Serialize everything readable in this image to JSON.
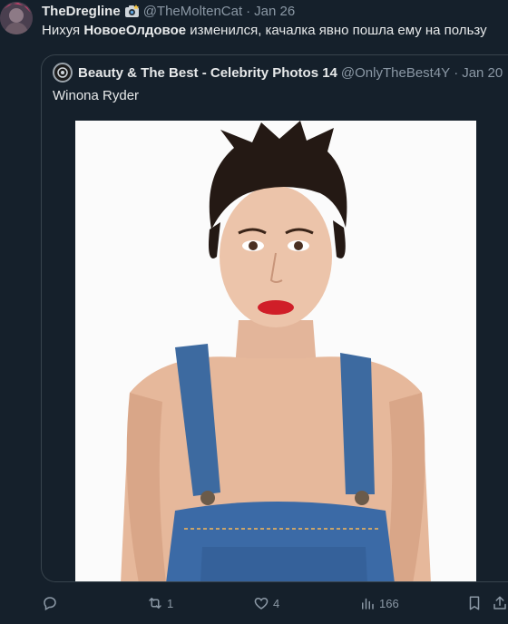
{
  "tweet": {
    "author_name": "TheDregline",
    "author_handle": "@TheMoltenCat",
    "separator": "·",
    "time": "Jan 26",
    "text_prefix": "Нихуя ",
    "text_bold": "НовоеОлдовое",
    "text_suffix": " изменился, качалка явно пошла ему на пользу"
  },
  "quote": {
    "author_name": "Beauty & The Best - Celebrity Photos 14",
    "author_handle": "@OnlyTheBest4Y",
    "separator": "·",
    "time": "Jan 20",
    "text": "Winona Ryder"
  },
  "actions": {
    "reply_icon": "reply-icon",
    "retweet_icon": "retweet-icon",
    "retweet_count": "1",
    "like_icon": "heart-icon",
    "like_count": "4",
    "views_icon": "views-icon",
    "views_count": "166",
    "bookmark_icon": "bookmark-icon",
    "share_icon": "share-icon"
  },
  "colors": {
    "background": "#15202b",
    "secondary_text": "#8b98a5",
    "border": "#38444d"
  }
}
